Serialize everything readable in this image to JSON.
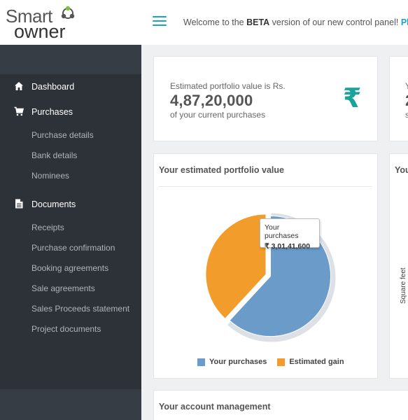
{
  "brand": {
    "line1": "Smart",
    "line2": "owner"
  },
  "header": {
    "welcome_prefix": "Welcome to the ",
    "welcome_bold": "BETA",
    "welcome_suffix": " version of our new control panel! ",
    "welcome_link": "Please le"
  },
  "sidebar": {
    "dashboard": "Dashboard",
    "purchases": "Purchases",
    "purchase_items": [
      "Purchase details",
      "Bank details",
      "Nominees"
    ],
    "documents": "Documents",
    "document_items": [
      "Receipts",
      "Purchase confirmation",
      "Booking agreements",
      "Sale agreements",
      "Sales Proceeds statement",
      "Project documents"
    ]
  },
  "stat": {
    "label": "Estimated portfolio value is Rs.",
    "value": "4,87,20,000",
    "sub": "of your current purchases",
    "icon": "rupee-icon",
    "color": "#1aa39a"
  },
  "stat2": {
    "line1": "Y",
    "line2": "2",
    "line3": "s"
  },
  "chart_card": {
    "title": "Your estimated portfolio value"
  },
  "chart_card2": {
    "title": "You",
    "ylabel": "Square feet"
  },
  "chart_data": {
    "type": "pie",
    "series": [
      {
        "name": "Your purchases",
        "value": 30141600,
        "color": "#6a9bc9"
      },
      {
        "name": "Estimated gain",
        "value": 18578400,
        "color": "#f29c2b"
      }
    ],
    "tooltip": {
      "title": "Your purchases",
      "value": "₹ 3,01,41,600"
    },
    "legend": "bottom"
  },
  "account": {
    "title": "Your account management"
  }
}
